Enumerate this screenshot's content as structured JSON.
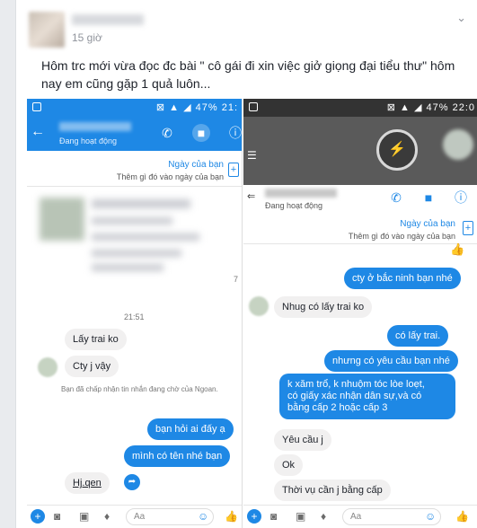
{
  "post": {
    "time": "15 giờ",
    "text": "Hôm trc mới vừa đọc đc bài \" cô gái đi xin việc giở giọng đại tiểu thư\" hôm nay em cũng gặp 1 quả luôn...",
    "chevron": "chevron-down-icon"
  },
  "left": {
    "status_bar": {
      "battery": "47%",
      "time": "21:"
    },
    "header": {
      "status": "Đang hoạt động"
    },
    "day": {
      "title": "Ngày của bạn",
      "subtitle": "Thêm gì đó vào ngày của bạn"
    },
    "page_num": "7",
    "timestamp": "21:51",
    "messages": [
      {
        "from": "in",
        "text": "Lấy trai ko"
      },
      {
        "from": "in",
        "text": "Cty j vậy"
      },
      {
        "from": "out",
        "text": "bạn hỏi ai đấy ạ"
      },
      {
        "from": "out",
        "text": "mình có tên nhé bạn"
      },
      {
        "from": "in",
        "text": "Hj.qen"
      }
    ],
    "note": "Bạn đã chấp nhận tin nhắn đang chờ của Ngoan.",
    "composer": {
      "placeholder": "Aa"
    }
  },
  "right": {
    "status_bar": {
      "battery": "47%",
      "time": "22:0"
    },
    "header": {
      "status": "Đang hoạt động"
    },
    "day": {
      "title": "Ngày của bạn",
      "subtitle": "Thêm gì đó vào ngày của bạn"
    },
    "messages": [
      {
        "from": "out",
        "text": "cty ở bắc ninh bạn nhé"
      },
      {
        "from": "in",
        "text": "Nhug có lấy trai ko"
      },
      {
        "from": "out",
        "text": "có lấy trai."
      },
      {
        "from": "out",
        "text": "nhưng có yêu cầu bạn nhé"
      },
      {
        "from": "out",
        "text": "k xăm trổ, k nhuộm tóc lòe loẹt,\ncó giấy xác nhận dân sự,và có\nbằng cấp 2 hoặc cấp 3"
      },
      {
        "from": "in",
        "text": "Yêu cầu j"
      },
      {
        "from": "in",
        "text": "Ok"
      },
      {
        "from": "in",
        "text": "Thời vụ cần j bằng cấp"
      }
    ],
    "composer": {
      "placeholder": "Aa"
    }
  },
  "colors": {
    "messenger_blue": "#1e88e5",
    "incoming_bubble": "#f1f0f0"
  }
}
